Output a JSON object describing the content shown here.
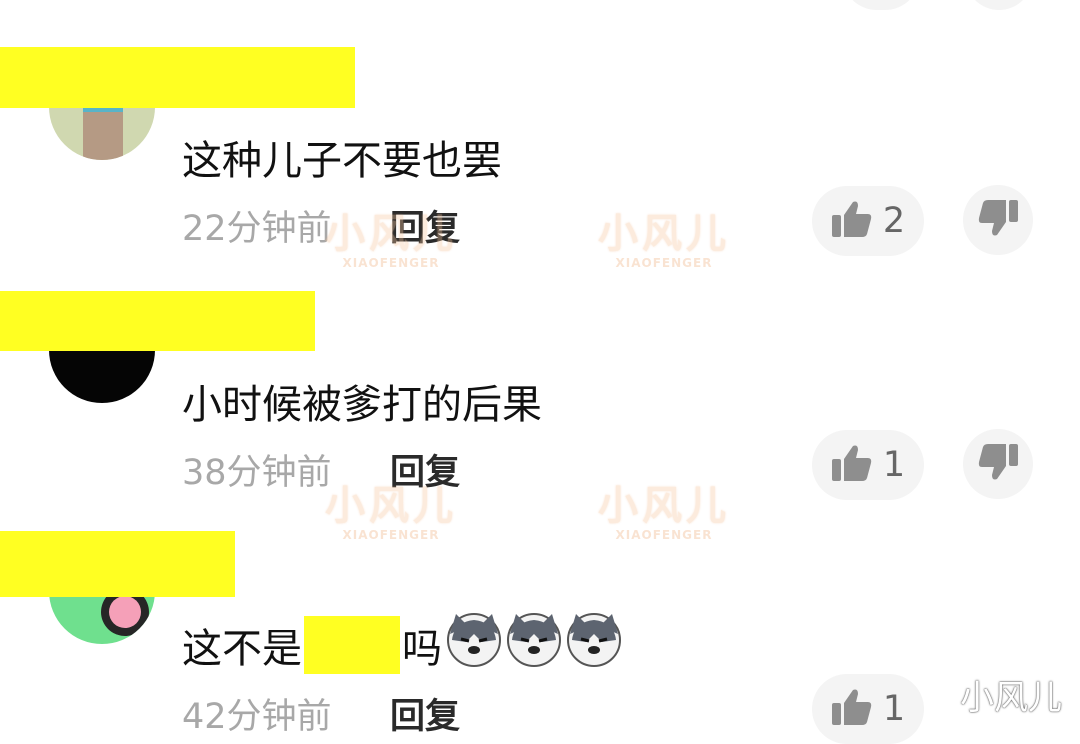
{
  "comments": [
    {
      "text": "这种儿子不要也罢",
      "time": "22分钟前",
      "reply_label": "回复",
      "like_count": "2"
    },
    {
      "text": "小时候被爹打的后果",
      "time": "38分钟前",
      "reply_label": "回复",
      "like_count": "1"
    },
    {
      "text_before": "这不是",
      "text_after": "吗",
      "time": "42分钟前",
      "reply_label": "回复",
      "like_count": "1"
    }
  ],
  "watermark": {
    "text": "小风儿",
    "sub": "XIAOFENGER"
  },
  "corner_watermark": "小风儿",
  "icons": {
    "like": "thumbs-up-icon",
    "dislike": "thumbs-down-icon",
    "emoji": "husky-dog-emoji"
  },
  "colors": {
    "redaction": "#ffff22",
    "secondary_text": "#a8a8a8",
    "button_bg": "#f4f4f4"
  }
}
